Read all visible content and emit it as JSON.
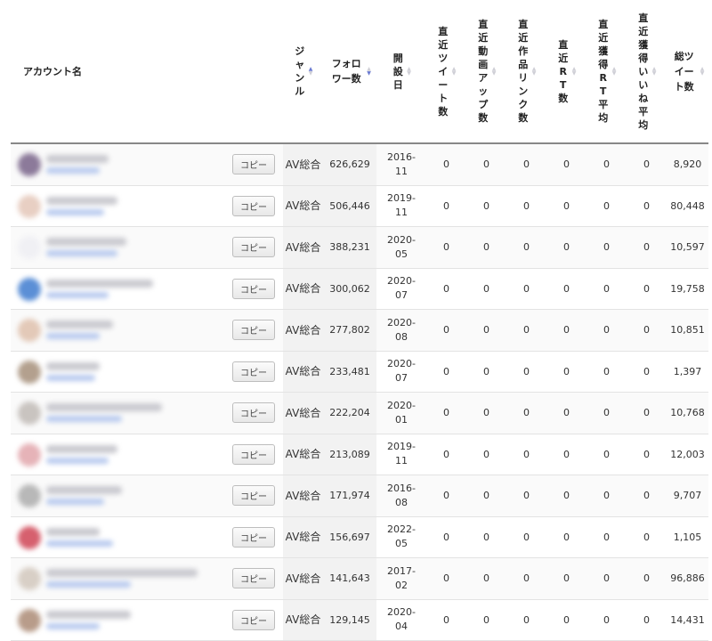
{
  "headers": {
    "account": "アカウント名",
    "genre": "ジャンル",
    "followers": "フォロワー数",
    "founded": "開設日",
    "recent_tweets": "直近ツイート数",
    "recent_videos": "直近動画アップ数",
    "recent_links": "直近作品リンク数",
    "recent_rt": "直近RT数",
    "recent_rt_avg": "直近獲得RT平均",
    "recent_likes_avg": "直近獲得いいね平均",
    "total_tweets": "総ツイート数"
  },
  "copy_label": "コピー",
  "rows": [
    {
      "avatar_color": "#8c7a9a",
      "genre": "AV総合",
      "followers": "626,629",
      "date_y": "2016-",
      "date_m": "11",
      "tweets": "0",
      "videos": "0",
      "links": "0",
      "rt": "0",
      "rt_avg": "0",
      "likes_avg": "0",
      "total": "8,920"
    },
    {
      "avatar_color": "#e8cfc3",
      "genre": "AV総合",
      "followers": "506,446",
      "date_y": "2019-",
      "date_m": "11",
      "tweets": "0",
      "videos": "0",
      "links": "0",
      "rt": "0",
      "rt_avg": "0",
      "likes_avg": "0",
      "total": "80,448"
    },
    {
      "avatar_color": "#f0f0f4",
      "genre": "AV総合",
      "followers": "388,231",
      "date_y": "2020-",
      "date_m": "05",
      "tweets": "0",
      "videos": "0",
      "links": "0",
      "rt": "0",
      "rt_avg": "0",
      "likes_avg": "0",
      "total": "10,597"
    },
    {
      "avatar_color": "#5b8fd6",
      "genre": "AV総合",
      "followers": "300,062",
      "date_y": "2020-",
      "date_m": "07",
      "tweets": "0",
      "videos": "0",
      "links": "0",
      "rt": "0",
      "rt_avg": "0",
      "likes_avg": "0",
      "total": "19,758"
    },
    {
      "avatar_color": "#e3c9b8",
      "genre": "AV総合",
      "followers": "277,802",
      "date_y": "2020-",
      "date_m": "08",
      "tweets": "0",
      "videos": "0",
      "links": "0",
      "rt": "0",
      "rt_avg": "0",
      "likes_avg": "0",
      "total": "10,851"
    },
    {
      "avatar_color": "#b3a08e",
      "genre": "AV総合",
      "followers": "233,481",
      "date_y": "2020-",
      "date_m": "07",
      "tweets": "0",
      "videos": "0",
      "links": "0",
      "rt": "0",
      "rt_avg": "0",
      "likes_avg": "0",
      "total": "1,397"
    },
    {
      "avatar_color": "#c9c4c0",
      "genre": "AV総合",
      "followers": "222,204",
      "date_y": "2020-",
      "date_m": "01",
      "tweets": "0",
      "videos": "0",
      "links": "0",
      "rt": "0",
      "rt_avg": "0",
      "likes_avg": "0",
      "total": "10,768"
    },
    {
      "avatar_color": "#e6b3b8",
      "genre": "AV総合",
      "followers": "213,089",
      "date_y": "2019-",
      "date_m": "11",
      "tweets": "0",
      "videos": "0",
      "links": "0",
      "rt": "0",
      "rt_avg": "0",
      "likes_avg": "0",
      "total": "12,003"
    },
    {
      "avatar_color": "#b8b8b8",
      "genre": "AV総合",
      "followers": "171,974",
      "date_y": "2016-",
      "date_m": "08",
      "tweets": "0",
      "videos": "0",
      "links": "0",
      "rt": "0",
      "rt_avg": "0",
      "likes_avg": "0",
      "total": "9,707"
    },
    {
      "avatar_color": "#d6606e",
      "genre": "AV総合",
      "followers": "156,697",
      "date_y": "2022-",
      "date_m": "05",
      "tweets": "0",
      "videos": "0",
      "links": "0",
      "rt": "0",
      "rt_avg": "0",
      "likes_avg": "0",
      "total": "1,105"
    },
    {
      "avatar_color": "#d8cfc6",
      "genre": "AV総合",
      "followers": "141,643",
      "date_y": "2017-",
      "date_m": "02",
      "tweets": "0",
      "videos": "0",
      "links": "0",
      "rt": "0",
      "rt_avg": "0",
      "likes_avg": "0",
      "total": "96,886"
    },
    {
      "avatar_color": "#b89c8a",
      "genre": "AV総合",
      "followers": "129,145",
      "date_y": "2020-",
      "date_m": "04",
      "tweets": "0",
      "videos": "0",
      "links": "0",
      "rt": "0",
      "rt_avg": "0",
      "likes_avg": "0",
      "total": "14,431"
    }
  ]
}
